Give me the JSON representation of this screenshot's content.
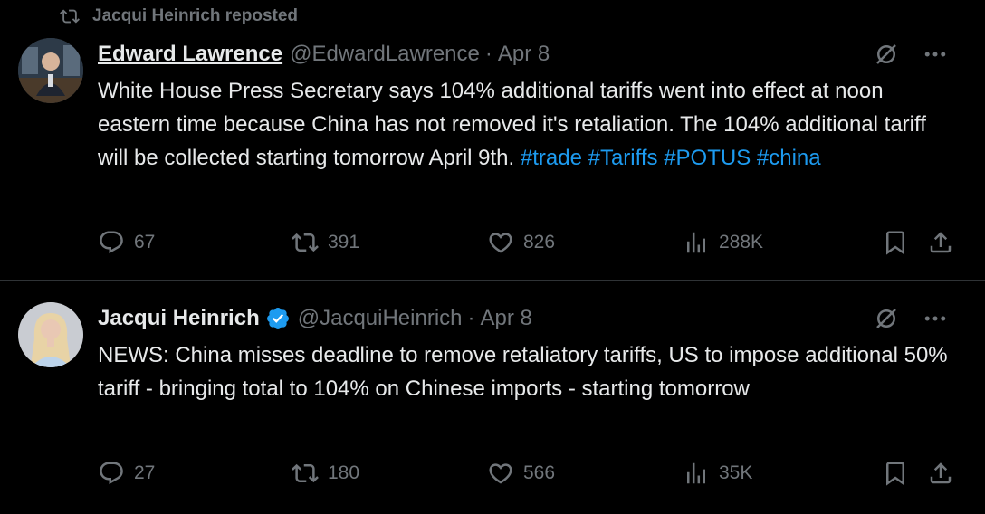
{
  "colors": {
    "background": "#000000",
    "text": "#e7e9ea",
    "muted": "#71767b",
    "link": "#1d9bf0",
    "verified": "#1d9bf0"
  },
  "repost_banner": {
    "icon": "repost-icon",
    "text": "Jacqui Heinrich reposted"
  },
  "tweets": [
    {
      "name": "Edward Lawrence",
      "handle": "@EdwardLawrence",
      "separator": "·",
      "date": "Apr 8",
      "text_plain": "White House Press Secretary says 104% additional tariffs went into effect at noon eastern time because China has not removed it's retaliation. The 104% additional tariff will be collected starting tomorrow April 9th. ",
      "hashtags": [
        "#trade",
        "#Tariffs",
        "#POTUS",
        "#china"
      ],
      "replies": "67",
      "reposts": "391",
      "likes": "826",
      "views": "288K"
    },
    {
      "name": "Jacqui Heinrich",
      "verified": true,
      "handle": "@JacquiHeinrich",
      "separator": "·",
      "date": "Apr 8",
      "text_plain": "NEWS: China misses deadline to remove retaliatory tariffs, US to impose additional 50% tariff - bringing total to 104% on Chinese imports - starting tomorrow",
      "replies": "27",
      "reposts": "180",
      "likes": "566",
      "views": "35K"
    }
  ]
}
